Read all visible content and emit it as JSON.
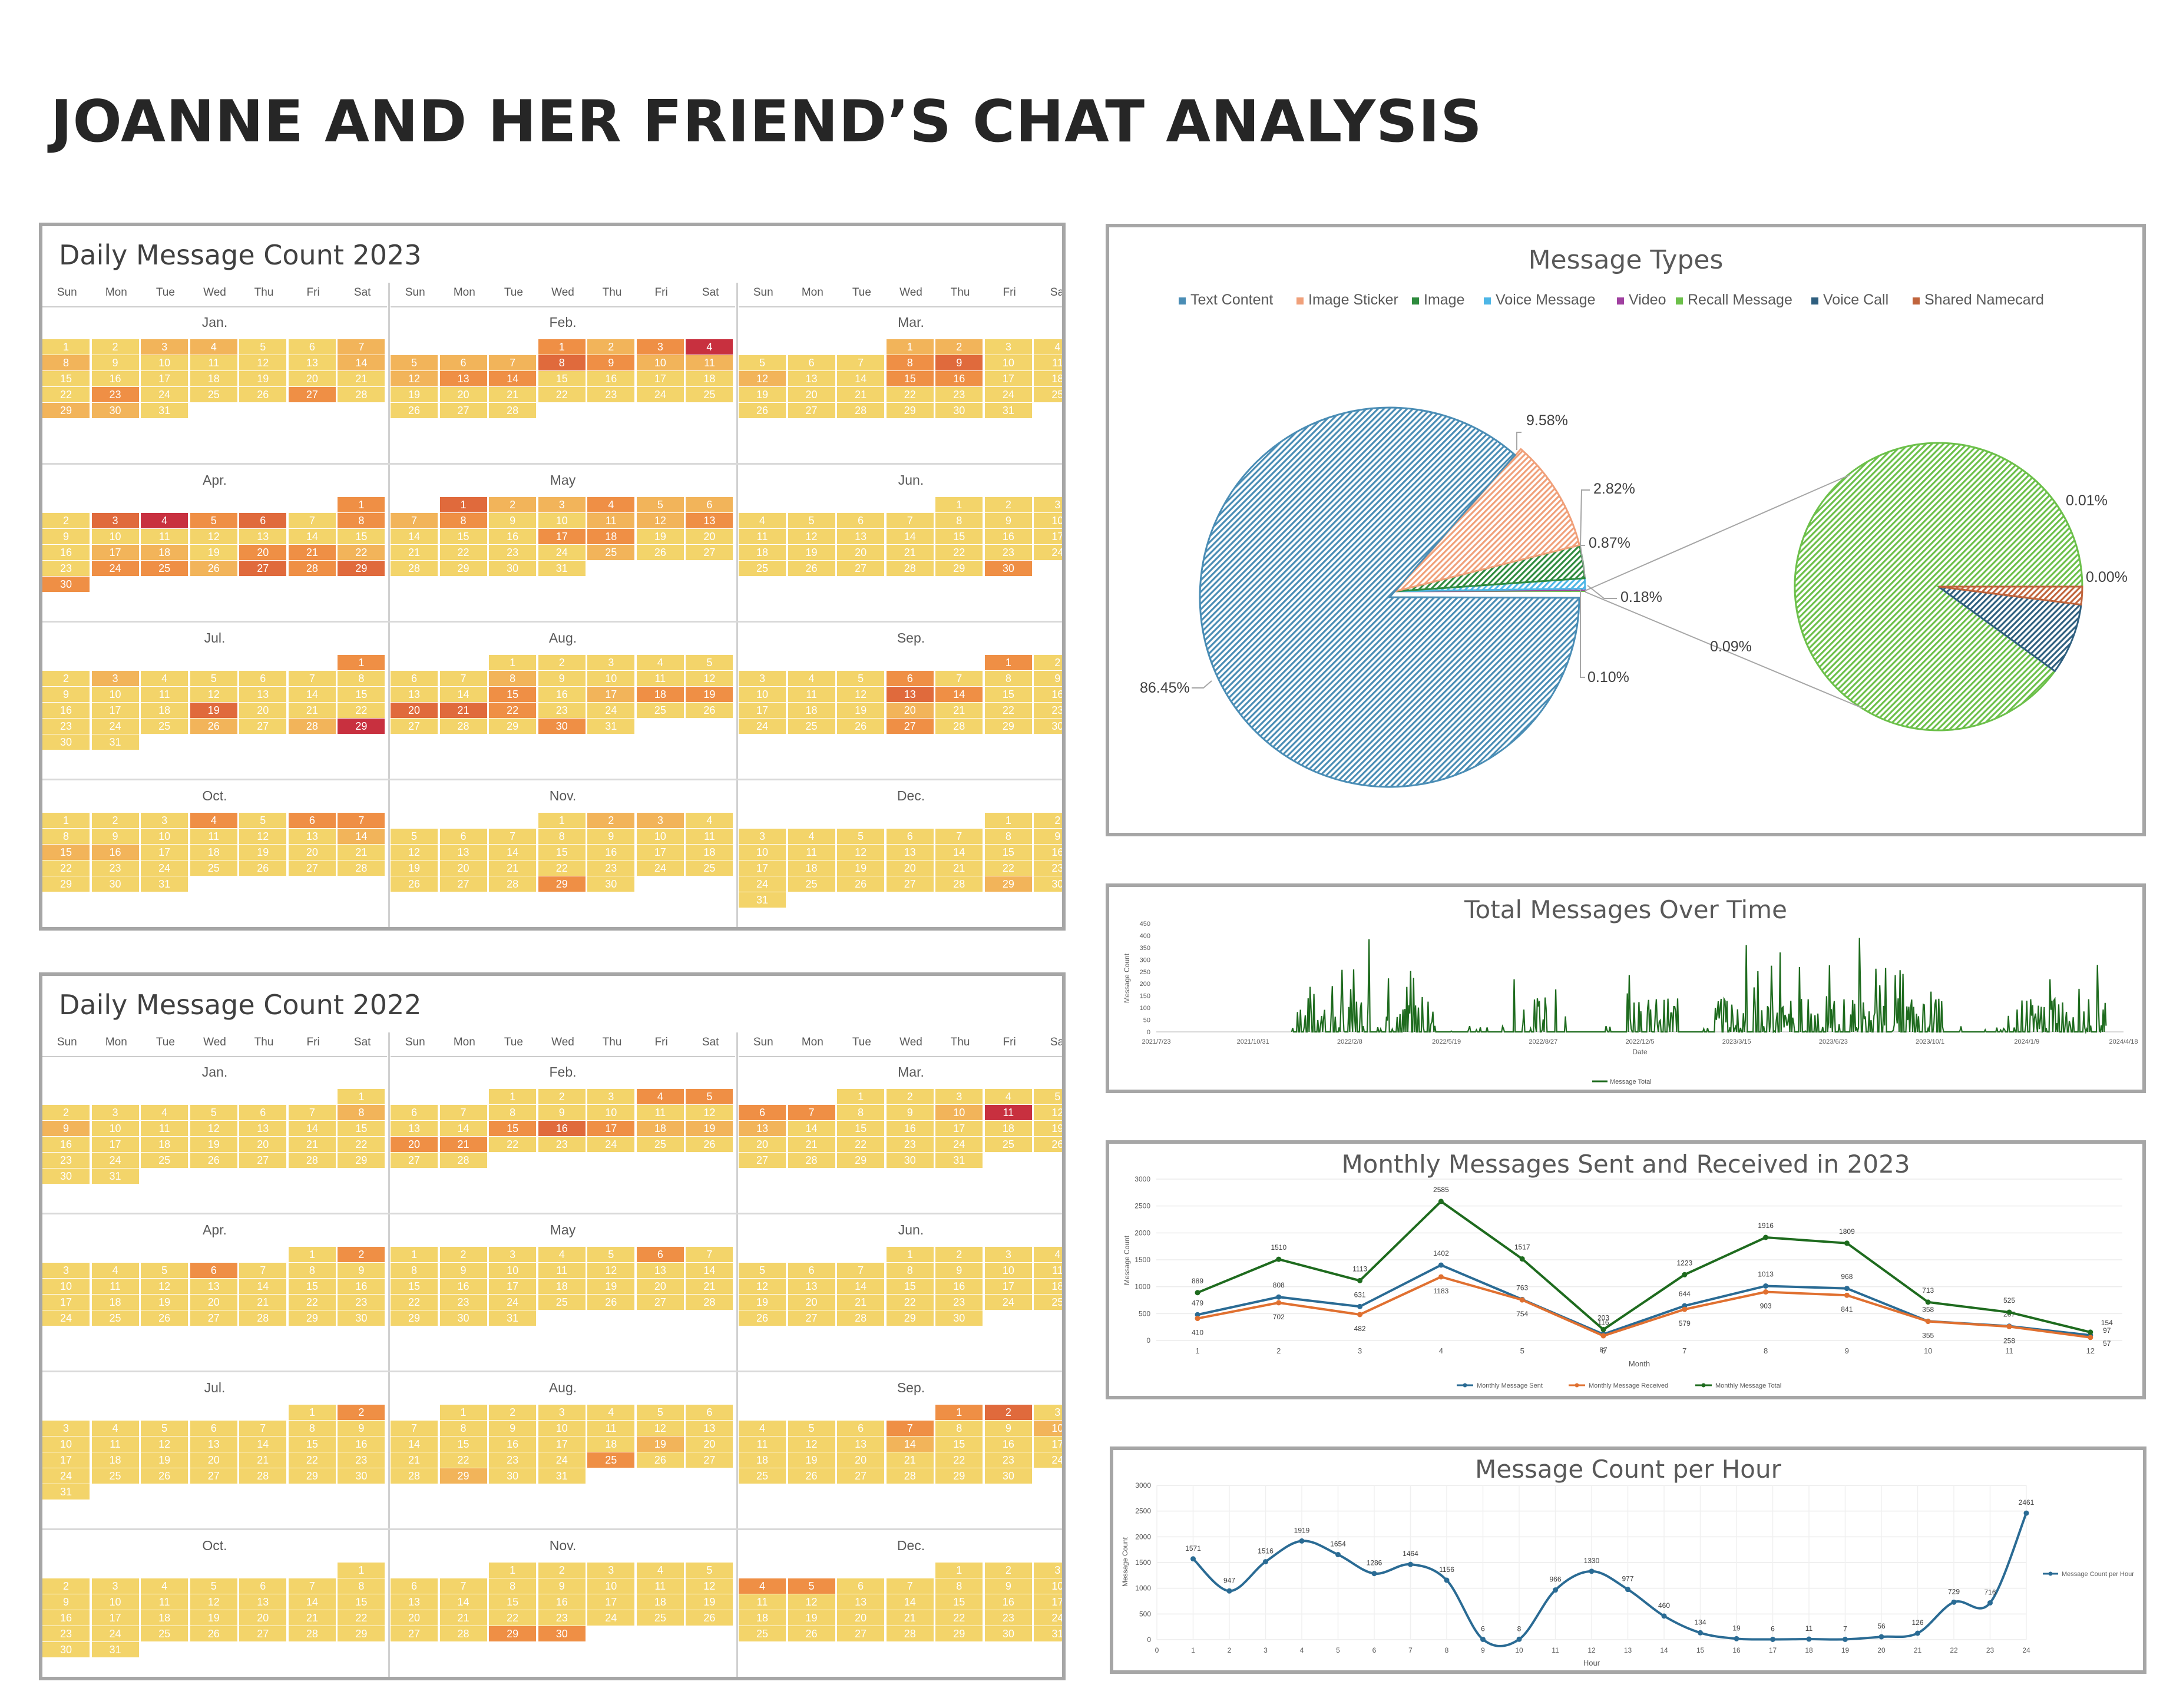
{
  "page_title": "JOANNE AND HER FRIEND’S CHAT ANALYSIS",
  "calendars": [
    {
      "title": "Daily Message Count 2023",
      "year": 2023,
      "day_headers": [
        "Sun",
        "Mon",
        "Tue",
        "Wed",
        "Thu",
        "Fri",
        "Sat"
      ],
      "month_labels": [
        "Jan.",
        "Feb.",
        "Mar.",
        "Apr.",
        "May",
        "Jun.",
        "Jul.",
        "Aug.",
        "Sep.",
        "Oct.",
        "Nov.",
        "Dec."
      ],
      "heat_levels": {
        "1": {
          "3": 1,
          "4": 1,
          "7": 1,
          "8": 1,
          "14": 1,
          "23": 2,
          "27": 2,
          "29": 1,
          "30": 1
        },
        "2": {
          "1": 2,
          "2": 1,
          "3": 2,
          "4": 4,
          "8": 3,
          "9": 2,
          "10": 1,
          "11": 1,
          "5": 1,
          "6": 1,
          "7": 1,
          "12": 1,
          "13": 2,
          "14": 2
        },
        "3": {
          "1": 1,
          "2": 1,
          "8": 2,
          "9": 3,
          "15": 2,
          "16": 2,
          "12": 1
        },
        "4": {
          "1": 2,
          "3": 3,
          "4": 4,
          "5": 2,
          "6": 3,
          "8": 2,
          "17": 1,
          "18": 1,
          "20": 2,
          "21": 2,
          "22": 1,
          "24": 2,
          "25": 2,
          "26": 1,
          "27": 3,
          "28": 2,
          "29": 3,
          "30": 2
        },
        "5": {
          "1": 3,
          "2": 1,
          "3": 1,
          "4": 2,
          "5": 1,
          "6": 1,
          "7": 1,
          "8": 2,
          "11": 1,
          "12": 1,
          "13": 2,
          "17": 2,
          "18": 2,
          "25": 1
        },
        "6": {
          "30": 2
        },
        "7": {
          "1": 2,
          "3": 1,
          "19": 3,
          "26": 1,
          "28": 1,
          "29": 4
        },
        "8": {
          "8": 1,
          "15": 2,
          "17": 1,
          "18": 2,
          "19": 2,
          "20": 3,
          "21": 3,
          "22": 2,
          "30": 2
        },
        "9": {
          "1": 2,
          "6": 2,
          "13": 3,
          "14": 2,
          "20": 1,
          "27": 2
        },
        "10": {
          "4": 2,
          "6": 2,
          "7": 2,
          "14": 1,
          "15": 1,
          "16": 1
        },
        "11": {
          "2": 1,
          "3": 1,
          "29": 2
        },
        "12": {
          "29": 1
        }
      }
    },
    {
      "title": "Daily Message Count 2022",
      "year": 2022,
      "day_headers": [
        "Sun",
        "Mon",
        "Tue",
        "Wed",
        "Thu",
        "Fri",
        "Sat"
      ],
      "month_labels": [
        "Jan.",
        "Feb.",
        "Mar.",
        "Apr.",
        "May",
        "Jun.",
        "Jul.",
        "Aug.",
        "Sep.",
        "Oct.",
        "Nov.",
        "Dec."
      ],
      "heat_levels": {
        "1": {
          "8": 1,
          "9": 1
        },
        "2": {
          "4": 2,
          "5": 2,
          "15": 2,
          "16": 3,
          "17": 2,
          "18": 1,
          "19": 1,
          "20": 2,
          "21": 2
        },
        "3": {
          "6": 2,
          "7": 2,
          "10": 1,
          "11": 4,
          "13": 1
        },
        "4": {
          "2": 2,
          "6": 2
        },
        "5": {
          "6": 2
        },
        "6": {},
        "7": {
          "2": 2
        },
        "8": {
          "19": 1,
          "25": 2,
          "29": 1
        },
        "9": {
          "1": 2,
          "2": 3,
          "7": 2,
          "10": 1,
          "14": 1
        },
        "10": {},
        "11": {
          "29": 2,
          "30": 2
        },
        "12": {
          "4": 2,
          "5": 2
        }
      }
    }
  ],
  "pie_chart": {
    "title": "Message Types",
    "legend": [
      {
        "name": "Text Content",
        "color": "#4a8db5"
      },
      {
        "name": "Image Sticker",
        "color": "#f0a07a"
      },
      {
        "name": "Image",
        "color": "#2e8b3e"
      },
      {
        "name": "Voice Message",
        "color": "#4db6e6"
      },
      {
        "name": "Video",
        "color": "#a040a0"
      },
      {
        "name": "Recall Message",
        "color": "#6cc04a"
      },
      {
        "name": "Voice Call",
        "color": "#2f5f7f"
      },
      {
        "name": "Shared Namecard",
        "color": "#c0643c"
      }
    ],
    "chart_data": {
      "type": "pie",
      "categories": [
        "Text Content",
        "Image Sticker",
        "Image",
        "Voice Message",
        "Video",
        "Recall Message",
        "Voice Call",
        "Shared Namecard"
      ],
      "values": [
        86.45,
        9.58,
        2.82,
        0.87,
        0.18,
        0.09,
        0.01,
        0.0
      ]
    },
    "labels": {
      "text_content": "86.45%",
      "image_sticker": "9.58%",
      "image": "2.82%",
      "voice_message": "0.87%",
      "video": "0.18%",
      "other_group": "0.10%",
      "recall": "0.09%",
      "voice_call": "0.01%",
      "namecard": "0.00%"
    }
  },
  "total_over_time": {
    "title": "Total Messages Over Time",
    "y_axis_label": "Message Count",
    "x_axis_label": "Date",
    "legend": "Message Total",
    "line_color": "#1e6b1e",
    "y_ticks": [
      "0",
      "50",
      "100",
      "150",
      "200",
      "250",
      "300",
      "350",
      "400",
      "450"
    ],
    "x_ticks": [
      "2021/7/23",
      "2021/10/31",
      "2022/2/8",
      "2022/5/19",
      "2022/8/27",
      "2022/12/5",
      "2023/3/15",
      "2023/6/23",
      "2023/10/1",
      "2024/1/9",
      "2024/4/18"
    ],
    "chart_data": {
      "type": "line",
      "ylim": [
        0,
        450
      ],
      "x_range": [
        "2021/7/23",
        "2024/4/18"
      ],
      "data_start": "2021/12/10",
      "data_end": "2024/3/31",
      "peaks": [
        {
          "x": "2022/2/28",
          "y": 385
        },
        {
          "x": "2023/3/25",
          "y": 360
        },
        {
          "x": "2023/7/20",
          "y": 390
        },
        {
          "x": "2023/4/29",
          "y": 330
        }
      ]
    }
  },
  "monthly_2023": {
    "title": "Monthly Messages Sent and Received in 2023",
    "y_axis_label": "Message Count",
    "x_axis_label": "Month",
    "y_ticks": [
      "0",
      "500",
      "1000",
      "1500",
      "2000",
      "2500",
      "3000"
    ],
    "x_ticks": [
      "1",
      "2",
      "3",
      "4",
      "5",
      "6",
      "7",
      "8",
      "9",
      "10",
      "11",
      "12"
    ],
    "chart_data": {
      "type": "line",
      "categories": [
        "1",
        "2",
        "3",
        "4",
        "5",
        "6",
        "7",
        "8",
        "9",
        "10",
        "11",
        "12"
      ],
      "ylim": [
        0,
        3000
      ],
      "series": [
        {
          "name": "Monthly Message Sent",
          "color": "#2a6b94",
          "values": [
            479,
            808,
            631,
            1402,
            763,
            116,
            644,
            1013,
            968,
            358,
            267,
            97
          ]
        },
        {
          "name": "Monthly Message Received",
          "color": "#e07030",
          "values": [
            410,
            702,
            482,
            1183,
            754,
            87,
            579,
            903,
            841,
            355,
            258,
            57
          ]
        },
        {
          "name": "Monthly Message Total",
          "color": "#1e6b1e",
          "values": [
            889,
            1510,
            1113,
            2585,
            1517,
            203,
            1223,
            1916,
            1809,
            713,
            525,
            154
          ]
        }
      ]
    }
  },
  "per_hour": {
    "title": "Message Count per Hour",
    "y_axis_label": "Message Count",
    "x_axis_label": "Hour",
    "legend": "Message Count per Hour",
    "line_color": "#2a6b94",
    "y_ticks": [
      "0",
      "500",
      "1000",
      "1500",
      "2000",
      "2500",
      "3000"
    ],
    "x_ticks": [
      "0",
      "1",
      "2",
      "3",
      "4",
      "5",
      "6",
      "7",
      "8",
      "9",
      "10",
      "11",
      "12",
      "13",
      "14",
      "15",
      "16",
      "17",
      "18",
      "19",
      "20",
      "21",
      "22",
      "23",
      "24"
    ],
    "chart_data": {
      "type": "line",
      "ylim": [
        0,
        3000
      ],
      "x": [
        1,
        2,
        3,
        4,
        5,
        6,
        7,
        8,
        9,
        10,
        11,
        12,
        13,
        14,
        15,
        16,
        17,
        18,
        19,
        20,
        21,
        22,
        23,
        24
      ],
      "values": [
        1571,
        947,
        1516,
        1919,
        1654,
        1286,
        1464,
        1156,
        6,
        8,
        966,
        1330,
        977,
        460,
        134,
        19,
        6,
        11,
        7,
        56,
        126,
        729,
        716,
        2461
      ]
    }
  }
}
